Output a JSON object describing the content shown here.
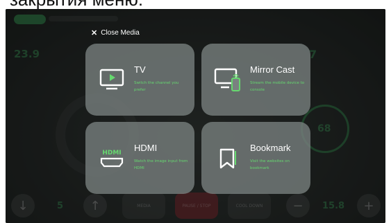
{
  "caption": {
    "text": "закрытия меню:"
  },
  "overlay": {
    "close_label": "Close Media",
    "tiles": [
      {
        "title": "TV",
        "description": "Switch the channel you prefer",
        "icon": "tv-icon"
      },
      {
        "title": "Mirror Cast",
        "description": "Stream the mobile device to console",
        "icon": "mirror-cast-icon"
      },
      {
        "title": "HDMI",
        "description": "Watch the image input from HDMI",
        "icon": "hdmi-icon"
      },
      {
        "title": "Bookmark",
        "description": "Visit the websites on bookmark",
        "icon": "bookmark-icon"
      }
    ]
  },
  "background": {
    "distance_value": "23.9",
    "incline_value": "5",
    "speed_value": "15.8",
    "gauge_value": "68",
    "side_value": "7",
    "bottom_labels": [
      "MEDIA",
      "PAUSE / STOP",
      "COOL DOWN"
    ]
  },
  "colors": {
    "accent_green": "#66d86f",
    "tile_bg": "#7a8280",
    "pause_red": "#a02832"
  }
}
